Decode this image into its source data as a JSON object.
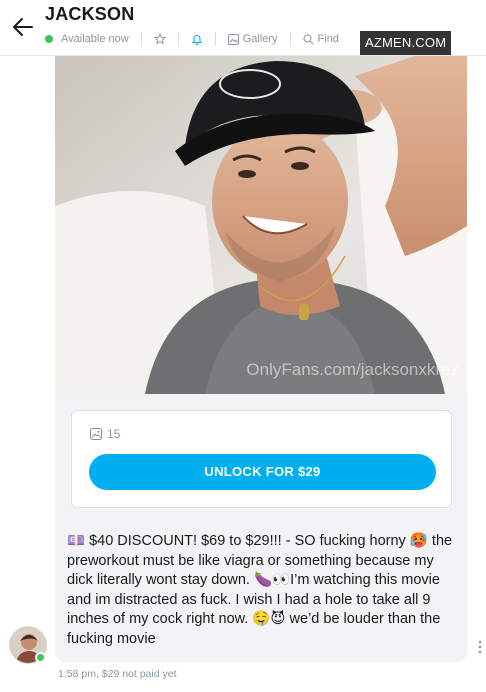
{
  "header": {
    "title": "JACKSON",
    "status": "Available now",
    "gallery_label": "Gallery",
    "find_label": "Find",
    "watermark": "AZMEN.COM",
    "icons": [
      "back-arrow-icon",
      "star-icon",
      "bell-icon",
      "image-icon",
      "search-icon"
    ]
  },
  "message": {
    "photo_watermark": "OnlyFans.com/jacksonxkrez",
    "media_count": "15",
    "unlock_label": "UNLOCK FOR $29",
    "text": "💷 $40 DISCOUNT! $69 to $29!!! - SO fucking horny 🥵 the preworkout must be like viagra or something because my dick literally wont stay down. 🍆👀I’m watching this movie and im distracted as fuck. I wish I had a hole to take all 9 inches of my cock right now. 🤤😈 we’d be louder than the fucking movie",
    "meta": "1:58 pm,  $29 not paid yet"
  },
  "colors": {
    "accent": "#00aff0",
    "online": "#35c759",
    "muted": "#8a96a3",
    "bubble": "#f2f3f5"
  }
}
